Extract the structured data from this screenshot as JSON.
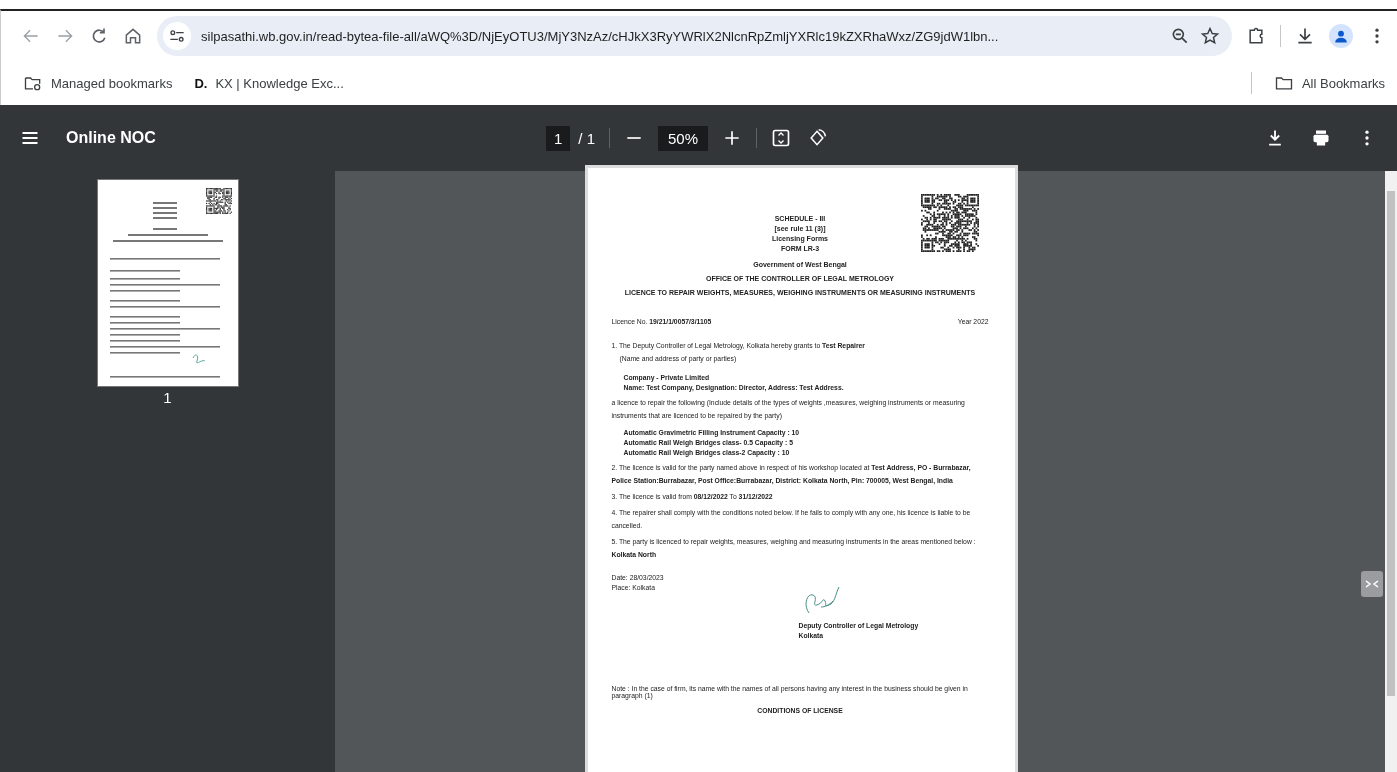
{
  "browser": {
    "url": "silpasathi.wb.gov.in/read-bytea-file-all/aWQ%3D/NjEyOTU3/MjY3NzAz/cHJkX3RyYWRlX2NlcnRpZmljYXRlc19kZXRhaWxz/ZG9jdW1lbn...",
    "bookmarks": [
      {
        "label": "Managed bookmarks",
        "kind": "managed"
      },
      {
        "label": "KX | Knowledge Exc...",
        "kind": "site",
        "icon_text": "D."
      }
    ],
    "all_bookmarks": "All Bookmarks"
  },
  "pdf_toolbar": {
    "title": "Online NOC",
    "page_current": "1",
    "page_total": "/ 1",
    "zoom": "50%"
  },
  "thumbnails": [
    {
      "label": "1"
    }
  ],
  "document": {
    "header_lines": [
      "SCHEDULE - III",
      "[see rule 11 (3)]",
      "Licensing Forms",
      "FORM LR-3"
    ],
    "government": "Government of West Bengal",
    "office": "OFFICE OF THE CONTROLLER OF LEGAL METROLOGY",
    "licence_title": "LICENCE TO REPAIR WEIGHTS, MEASURES, WEIGHING INSTRUMENTS OR MEASURING INSTRUMENTS",
    "licence_no": "Licence No. **19/21/1/0057/3/1105**",
    "year": "Year 2022",
    "body": [
      {
        "kind": "item",
        "text": "1. The Deputy Controller of Legal Metrology, Kolkata hereby grants to  **Test Repairer**"
      },
      {
        "kind": "note",
        "text": "(Name and address of party or parties)"
      },
      {
        "kind": "bold",
        "text": "Company - Private Limited"
      },
      {
        "kind": "bold",
        "text": "Name: Test Company, Designation: Director, Address: Test Address."
      },
      {
        "kind": "item",
        "text": "a licence to repair the following (Include details of the types of weights ,measures, weighing instruments or measuring instruments that are licenced to be repaired by the party)"
      },
      {
        "kind": "bold",
        "text": "Automatic Gravimetric Filling Instrument    Capacity : 10"
      },
      {
        "kind": "bold",
        "text": "Automatic Rail Weigh Bridges class- 0.5    Capacity : 5"
      },
      {
        "kind": "bold",
        "text": "Automatic Rail Weigh Bridges class-2    Capacity : 10"
      },
      {
        "kind": "item",
        "text": "2. The licence is valid for the party named above in respect of his workshop located at **Test Address, PO - Burrabazar, Police Station:Burrabazar, Post Office:Burrabazar, District: Kolkata North, Pin: 700005, West Bengal, India**"
      },
      {
        "kind": "item",
        "text": "3. The licence is valid from **08/12/2022** To **31/12/2022**"
      },
      {
        "kind": "item",
        "text": "4. The repairer shall comply with the conditions noted below. If he fails to comply with any one, his licence is liable to be cancelled."
      },
      {
        "kind": "item",
        "text": "5. The party is licenced to repair weights, measures, weighing and measuring instruments in the areas mentioned below :   **Kolkata North**"
      }
    ],
    "date": "Date: 28/03/2023",
    "place": "Place: Kolkata",
    "signatory": [
      "Deputy Controller of Legal Metrology",
      "Kolkata"
    ],
    "note": "Note : In the case of firm, its name with the names of all persons having any interest in the business should be given in paragraph (1)",
    "conditions_heading": "CONDITIONS OF LICENSE"
  }
}
